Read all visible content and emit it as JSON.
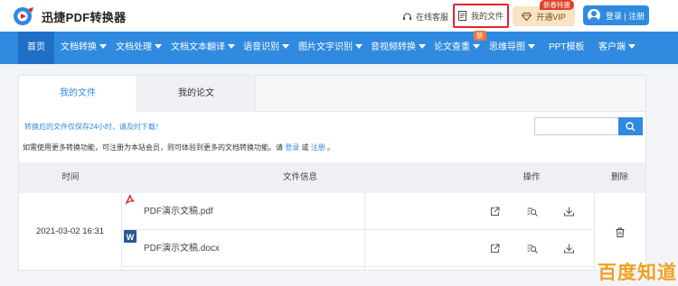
{
  "header": {
    "brand": "迅捷PDF转换器",
    "support_label": "在线客服",
    "my_files_label": "我的文件",
    "vip_label": "开通VIP",
    "vip_badge": "新春特惠",
    "login_label": "登录 | 注册"
  },
  "nav": {
    "items": [
      {
        "label": "首页",
        "caret": false
      },
      {
        "label": "文档转换",
        "caret": true
      },
      {
        "label": "文档处理",
        "caret": true
      },
      {
        "label": "文档文本翻译",
        "caret": true
      },
      {
        "label": "语音识别",
        "caret": true
      },
      {
        "label": "图片文字识别",
        "caret": true
      },
      {
        "label": "音视频转换",
        "caret": true
      },
      {
        "label": "论文查重",
        "caret": true
      },
      {
        "label": "思维导图",
        "caret": true
      },
      {
        "label": "PPT模板",
        "caret": false
      },
      {
        "label": "客户端",
        "caret": true
      }
    ],
    "new_badge": "新"
  },
  "tabs": {
    "active": "我的文件",
    "other": "我的论文"
  },
  "notice": "转换后的文件仅保存24小时，请及时下载！",
  "search": {
    "placeholder": ""
  },
  "hint": {
    "prefix": "如需使用更多转换功能，可注册为本站会员，则可体验到更多的文档转换功能。请",
    "login": "登录",
    "or": "或",
    "register": "注册",
    "suffix": "。"
  },
  "table": {
    "headers": {
      "time": "时间",
      "info": "文件信息",
      "actions": "操作",
      "delete": "删除"
    },
    "time": "2021-03-02 16:31",
    "files": [
      {
        "name": "PDF演示文稿.pdf",
        "icon": "pdf-icon"
      },
      {
        "name": "PDF演示文稿.docx",
        "icon": "word-icon"
      }
    ]
  },
  "watermark": "百度知道",
  "colors": {
    "primary": "#2f8ae0",
    "highlight": "#e3242b",
    "vip": "#f8e3c4",
    "badge": "#e2402a"
  }
}
